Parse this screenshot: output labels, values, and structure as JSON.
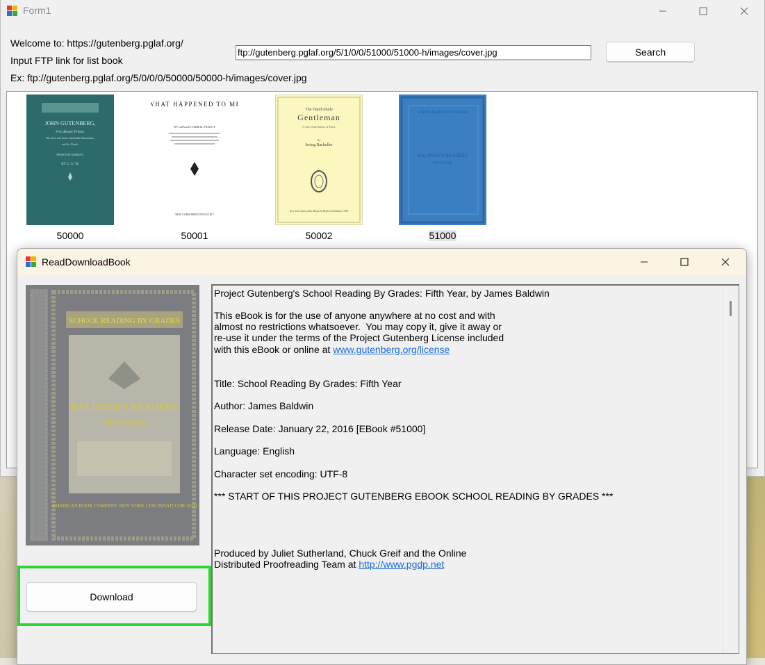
{
  "form1": {
    "title": "Form1",
    "welcome_label": "Welcome to: https://gutenberg.pglaf.org/",
    "input_label": "Input FTP link for list book",
    "example_label": "Ex: ftp://gutenberg.pglaf.org/5/0/0/0/50000/50000-h/images/cover.jpg",
    "ftp_input_value": "ftp://gutenberg.pglaf.org/5/1/0/0/51000/51000-h/images/cover.jpg",
    "search_label": "Search",
    "books": [
      {
        "id": "50000",
        "cover_lines": [
          "JOHN GUTENBERG,",
          "First Master Printer,",
          "His Acts, and most remarkable Discourses,",
          "and his Death.",
          "FROM THE GERMAN.",
          "BY C. G. W."
        ]
      },
      {
        "id": "50001",
        "cover_title": "WHAT HAPPENED TO ME",
        "cover_author": "BY LaSALLE CORBELL PICKETT",
        "cover_imprint": "NEW YORK BRENTANO'S 1917"
      },
      {
        "id": "50002",
        "cover_over": "The Hand-Made",
        "cover_title": "Gentleman",
        "cover_sub": "A Tale of the Battles of Peace",
        "cover_by": "By",
        "cover_author": "Irving Bacheller",
        "cover_imprint": "New York and London Harper & Brothers Publishers 1909"
      },
      {
        "id": "51000",
        "cover_top": "SCHOOL READING BY GRADES",
        "cover_title": "BALDWIN'S READERS",
        "cover_sub": "FIFTH YEAR"
      }
    ]
  },
  "reader": {
    "title": "ReadDownloadBook",
    "cover_top": "SCHOOL READING BY GRADES",
    "cover_title": "BALDWIN'S READERS",
    "cover_sub": "FIFTH YEAR",
    "cover_imprint": "AMERICAN BOOK COMPANY NEW YORK CINCINNATI CHICAGO",
    "download_label": "Download",
    "text": {
      "line_1": "Project Gutenberg's School Reading By Grades: Fifth Year, by James Baldwin",
      "line_2": "This eBook is for the use of anyone anywhere at no cost and with",
      "line_3": "almost no restrictions whatsoever.  You may copy it, give it away or",
      "line_4": "re-use it under the terms of the Project Gutenberg License included",
      "line_5": "with this eBook or online at ",
      "link_license": "www.gutenberg.org/license",
      "title_line": "Title: School Reading By Grades: Fifth Year",
      "author_line": "Author: James Baldwin",
      "release_line": "Release Date: January 22, 2016 [EBook #51000]",
      "language_line": "Language: English",
      "charset_line": "Character set encoding: UTF-8",
      "start_line": "*** START OF THIS PROJECT GUTENBERG EBOOK SCHOOL READING BY GRADES ***",
      "produced_line": "Produced by Juliet Sutherland, Chuck Greif and the Online",
      "distributed_line": "Distributed Proofreading Team at ",
      "link_pgdp": "http://www.pgdp.net"
    }
  },
  "icons": [
    "app-icon",
    "minimize-icon",
    "maximize-icon",
    "close-icon"
  ],
  "colors": {
    "highlight": "#2fd62f",
    "link": "#1a6ddb",
    "window_bg": "#f0f0f0"
  }
}
